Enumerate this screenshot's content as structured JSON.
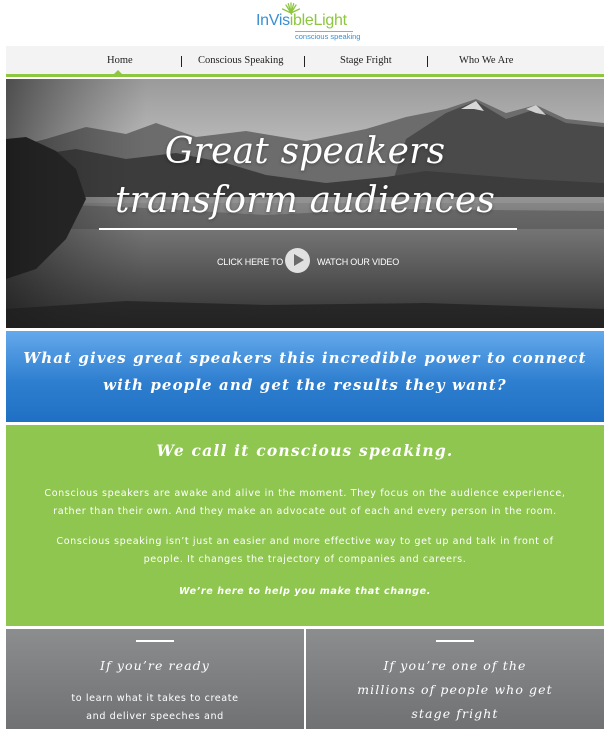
{
  "logo": {
    "text_part1": "InVis",
    "text_part2": "ible",
    "text_part3": "Light",
    "tagline": "conscious speaking",
    "colors": {
      "blue": "#3b8fd1",
      "green": "#8dc63f"
    }
  },
  "nav": {
    "items": [
      {
        "label": "Home",
        "active": true
      },
      {
        "label": "Conscious Speaking"
      },
      {
        "label": "Stage Fright"
      },
      {
        "label": "Who We Are"
      }
    ]
  },
  "hero": {
    "title_line1": "Great speakers",
    "title_line2": "transform audiences",
    "cta_left": "CLICK HERE TO",
    "cta_right": "WATCH OUR VIDEO",
    "play_icon": "play-icon"
  },
  "power": {
    "line1": "What gives great speakers this incredible power to connect",
    "line2": "with people and get the results they want?"
  },
  "conscious": {
    "title": "We call it conscious speaking.",
    "para1_line1": "Conscious speakers are awake and alive in the moment. They focus on the audience experience,",
    "para1_line2": "rather than their own. And they make an advocate out of each and every person in the room.",
    "para2_line1": "Conscious speaking isn’t just an easier and more effective way to get up and talk in front of",
    "para2_line2": "people. It changes the trajectory of companies and careers.",
    "cta": "We’re here to help you make that change."
  },
  "columns": {
    "left": {
      "heading": "If you’re ready",
      "body_line1": "to learn what it takes to create",
      "body_line2": "and deliver speeches and"
    },
    "right": {
      "heading_line1": "If you’re one of the",
      "heading_line2": "millions of people who get",
      "heading_line3": "stage fright"
    }
  },
  "colors": {
    "accent_green": "#8ec650",
    "band_blue": "#2f7fd0",
    "band_gray": "#7d7f81",
    "nav_bg": "#f3f3f3"
  }
}
